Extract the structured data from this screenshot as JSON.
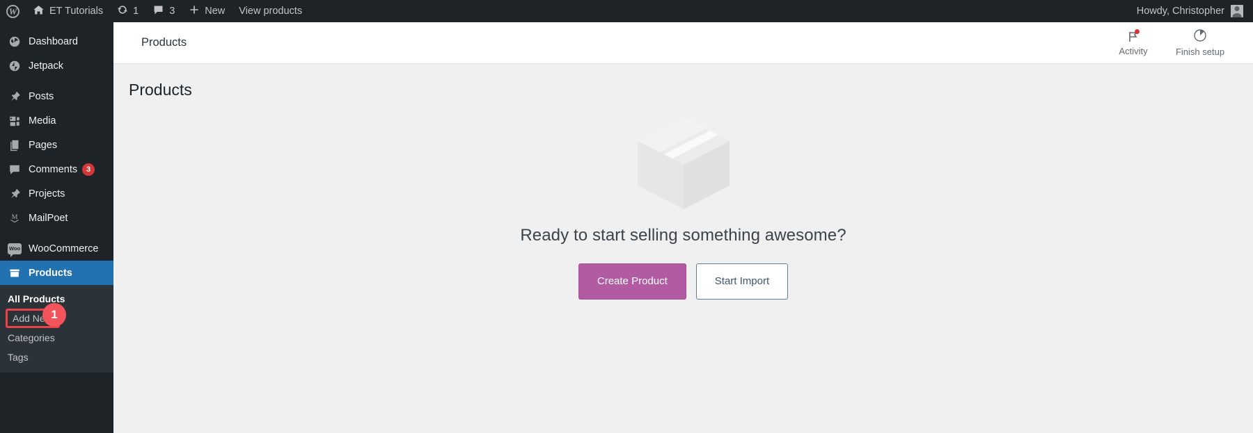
{
  "adminbar": {
    "logo_icon": "wordpress-logo-icon",
    "items": [
      {
        "icon": "home-icon",
        "label": "ET Tutorials"
      },
      {
        "icon": "updates-icon",
        "label": "1"
      },
      {
        "icon": "comment-bubble-icon",
        "label": "3"
      },
      {
        "icon": "plus-icon",
        "label": "New"
      },
      {
        "icon": "",
        "label": "View products"
      }
    ],
    "howdy": "Howdy, Christopher",
    "avatar_icon": "user-avatar-icon"
  },
  "sidebar": {
    "items": [
      {
        "label": "Dashboard",
        "icon": "dashboard-icon",
        "badge": ""
      },
      {
        "label": "Jetpack",
        "icon": "jetpack-icon",
        "badge": ""
      },
      {
        "label": "Posts",
        "icon": "pin-icon",
        "badge": ""
      },
      {
        "label": "Media",
        "icon": "media-icon",
        "badge": ""
      },
      {
        "label": "Pages",
        "icon": "pages-icon",
        "badge": ""
      },
      {
        "label": "Comments",
        "icon": "comment-bubble-icon",
        "badge": "3"
      },
      {
        "label": "Projects",
        "icon": "pin-icon",
        "badge": ""
      },
      {
        "label": "MailPoet",
        "icon": "mailpoet-icon",
        "badge": ""
      },
      {
        "label": "WooCommerce",
        "icon": "woocommerce-icon",
        "badge": ""
      },
      {
        "label": "Products",
        "icon": "products-icon",
        "badge": ""
      }
    ],
    "submenu": [
      {
        "label": "All Products",
        "state": "current"
      },
      {
        "label": "Add New",
        "state": "highlighted"
      },
      {
        "label": "Categories",
        "state": "normal"
      },
      {
        "label": "Tags",
        "state": "normal"
      }
    ],
    "annotation_badge": "1"
  },
  "woo_header": {
    "title": "Products",
    "actions": [
      {
        "label": "Activity",
        "icon": "flag-icon",
        "has_dot": true
      },
      {
        "label": "Finish setup",
        "icon": "progress-circle-icon",
        "has_dot": false
      }
    ]
  },
  "page": {
    "title": "Products",
    "empty_state": {
      "illustration": "package-box-icon",
      "heading": "Ready to start selling something awesome?",
      "primary_button": "Create Product",
      "secondary_button": "Start Import"
    }
  },
  "colors": {
    "adminbar_bg": "#1d2327",
    "sidebar_bg": "#1d2327",
    "submenu_bg": "#2c3338",
    "active_blue": "#2271b1",
    "badge_red": "#d63638",
    "annotation_red": "#f2545b",
    "highlight_box": "#e8424a",
    "primary_purple": "#b25ba3",
    "secondary_border": "#5d7e9c"
  }
}
